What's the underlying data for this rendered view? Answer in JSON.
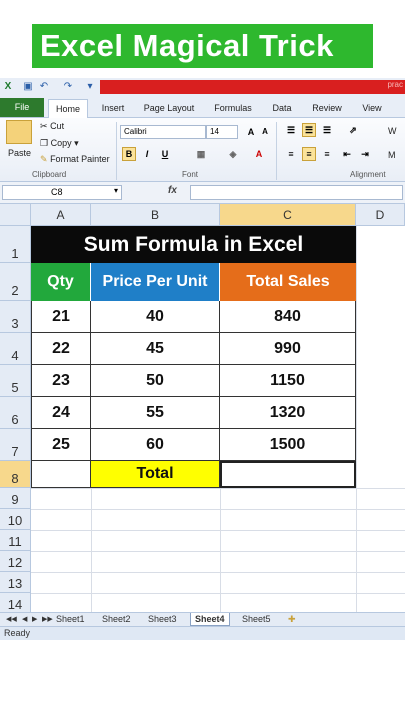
{
  "banner": {
    "title": "Excel Magical Trick"
  },
  "qat": {
    "title_fragment": "prac"
  },
  "tabs": [
    "File",
    "Home",
    "Insert",
    "Page Layout",
    "Formulas",
    "Data",
    "Review",
    "View"
  ],
  "ribbon": {
    "cut": "Cut",
    "copy": "Copy",
    "format_painter": "Format Painter",
    "paste": "Paste",
    "clipboard_label": "Clipboard",
    "font_name": "Calibri",
    "font_size": "14",
    "grow": "A",
    "shrink": "A",
    "bold": "B",
    "italic": "I",
    "underline": "U",
    "font_color": "A",
    "font_label": "Font",
    "alignment_label": "Alignment",
    "wrap_fragment": "W",
    "merge_fragment": "M"
  },
  "formula_bar": {
    "name_box": "C8",
    "fx": "fx",
    "formula": ""
  },
  "columns": [
    "A",
    "B",
    "C",
    "D"
  ],
  "rows": [
    "1",
    "2",
    "3",
    "4",
    "5",
    "6",
    "7",
    "8",
    "9",
    "10",
    "11",
    "12",
    "13",
    "14"
  ],
  "table": {
    "title": "Sum Formula in Excel",
    "headers": [
      "Qty",
      "Price Per Unit",
      "Total Sales"
    ],
    "header_colors": [
      "#22a83c",
      "#1f7fc8",
      "#e56d1a"
    ],
    "data": [
      [
        "21",
        "40",
        "840"
      ],
      [
        "22",
        "45",
        "990"
      ],
      [
        "23",
        "50",
        "1150"
      ],
      [
        "24",
        "55",
        "1320"
      ],
      [
        "25",
        "60",
        "1500"
      ]
    ],
    "total_label": "Total",
    "total_value": "",
    "total_label_color": "#ffff00"
  },
  "sheets": [
    "Sheet1",
    "Sheet2",
    "Sheet3",
    "Sheet4",
    "Sheet5"
  ],
  "active_sheet": "Sheet4",
  "status": "Ready"
}
